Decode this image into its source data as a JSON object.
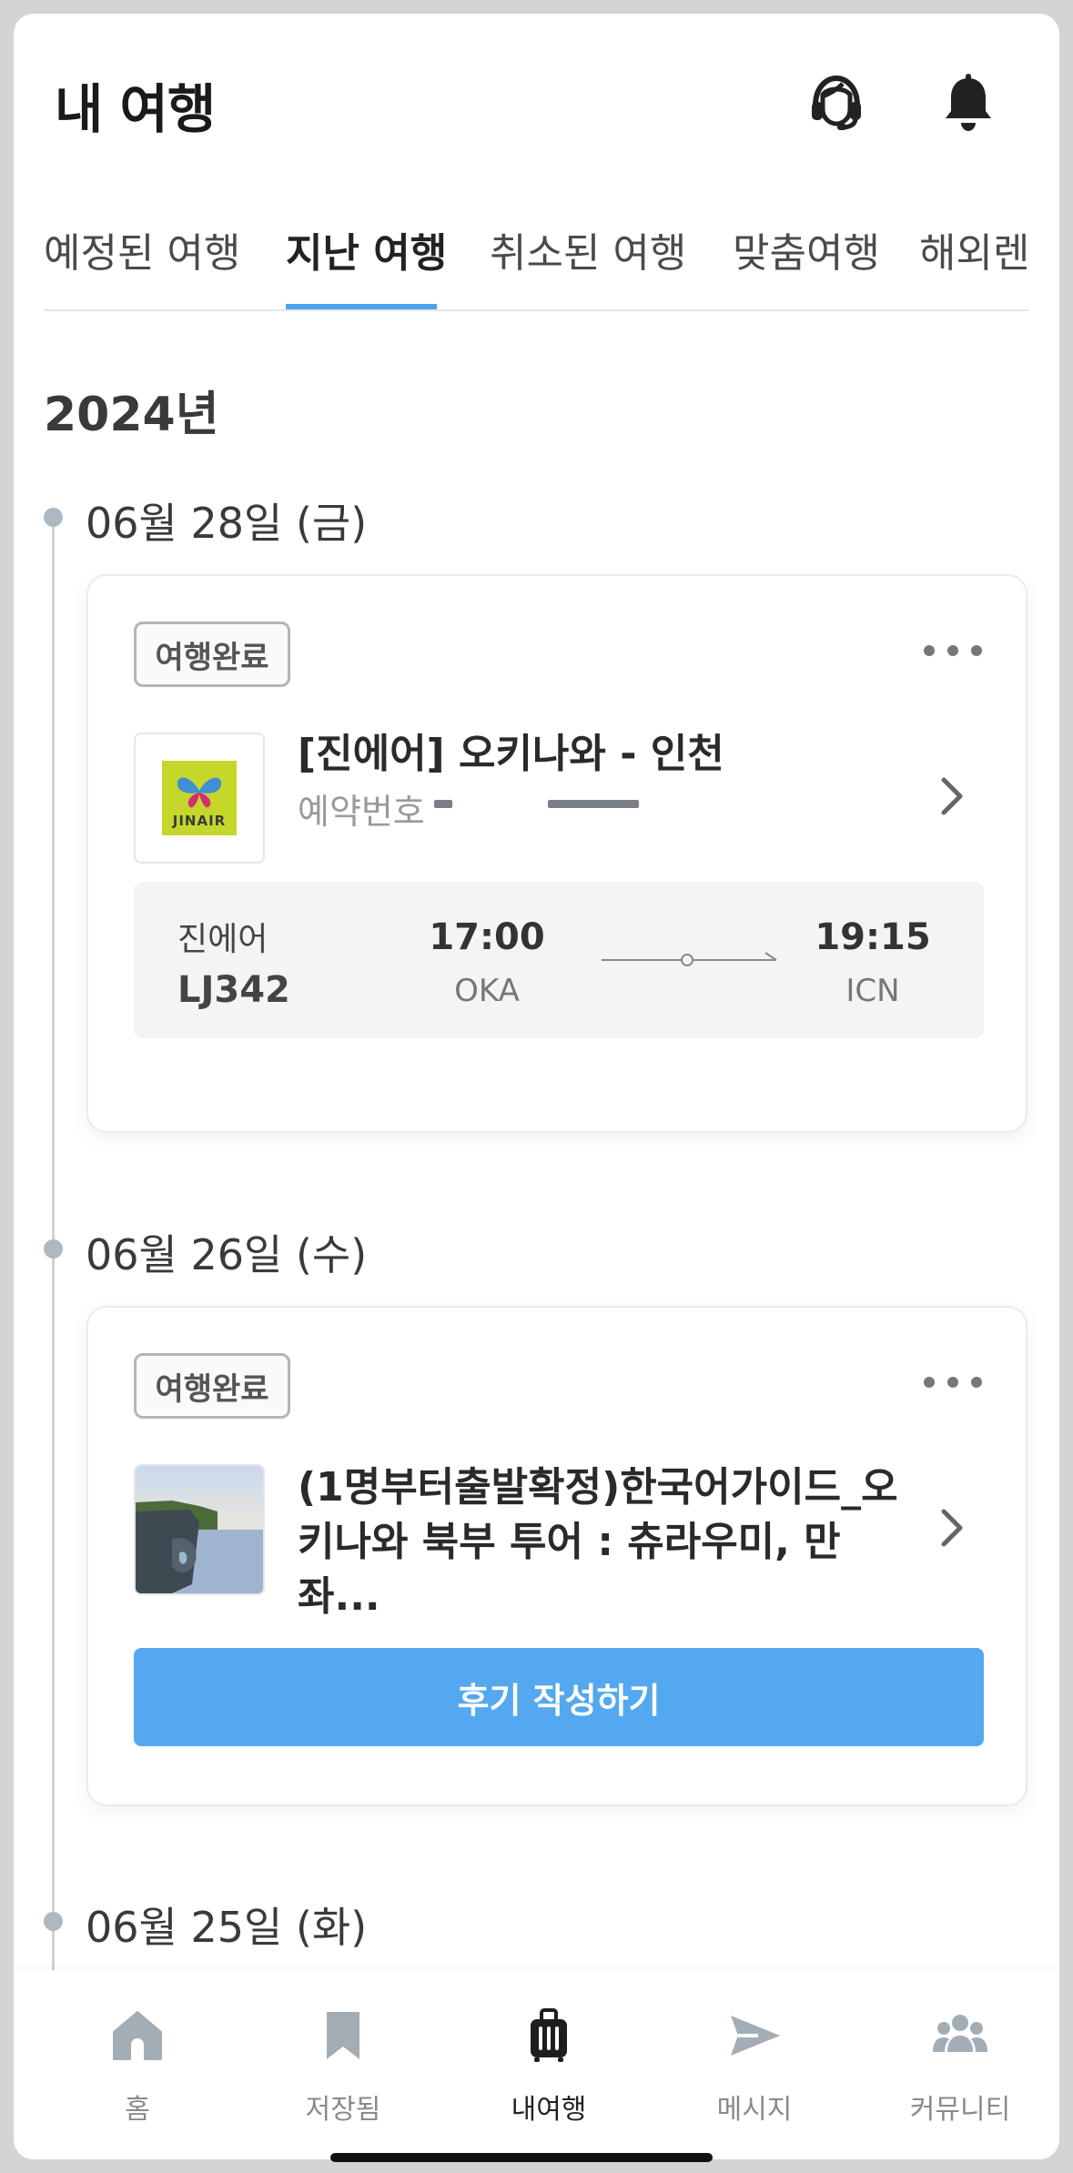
{
  "header": {
    "title": "내 여행",
    "icons": [
      "headset-icon",
      "bell-icon"
    ]
  },
  "tabs": [
    {
      "label": "예정된 여행",
      "active": false
    },
    {
      "label": "지난 여행",
      "active": true
    },
    {
      "label": "취소된 여행",
      "active": false
    },
    {
      "label": "맞춤여행",
      "active": false
    },
    {
      "label": "해외렌",
      "active": false
    }
  ],
  "year_label": "2024년",
  "trips": [
    {
      "date": "06월 28일 (금)",
      "badge": "여행완료",
      "title": "[진에어] 오키나와 - 인천",
      "booking_label": "예약번호",
      "flight": {
        "airline": "진에어",
        "flight_no": "LJ342",
        "depart_time": "17:00",
        "depart_code": "OKA",
        "arrive_time": "19:15",
        "arrive_code": "ICN"
      },
      "logo_text": "JINAIR"
    },
    {
      "date": "06월 26일 (수)",
      "badge": "여행완료",
      "title_line1": "(1명부터출발확정)한국어가이드_오",
      "title_line2": "키나와 북부 투어 : 츄라우미, 만좌...",
      "review_button": "후기 작성하기"
    },
    {
      "date": "06월 25일 (화)"
    }
  ],
  "bottom_nav": [
    {
      "label": "홈",
      "icon": "home-icon",
      "active": false
    },
    {
      "label": "저장됨",
      "icon": "bookmark-icon",
      "active": false
    },
    {
      "label": "내여행",
      "icon": "suitcase-icon",
      "active": true
    },
    {
      "label": "메시지",
      "icon": "send-icon",
      "active": false
    },
    {
      "label": "커뮤니티",
      "icon": "community-icon",
      "active": false
    }
  ],
  "colors": {
    "accent": "#4aa3ec",
    "button": "#53a8ef",
    "timeline": "#c9d3dc",
    "jinair_green": "#c5d72a"
  }
}
